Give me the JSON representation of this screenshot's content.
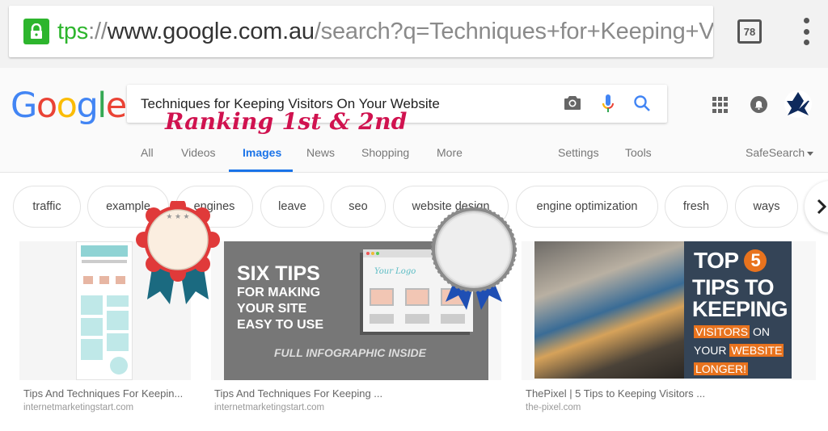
{
  "browser": {
    "url": {
      "scheme": "tps",
      "separator": "://",
      "host": "www.google.com.au",
      "path": "/search?q=Techniques+for+Keeping+V"
    },
    "tab_count": "78",
    "icons": [
      "lock-icon",
      "tab-switcher-icon",
      "overflow-menu-icon"
    ]
  },
  "google": {
    "logo": [
      "G",
      "o",
      "o",
      "g",
      "l",
      "e"
    ],
    "search": {
      "query": "Techniques for Keeping Visitors On Your Website",
      "icons": [
        "camera-icon",
        "microphone-icon",
        "search-icon"
      ]
    },
    "annotation": "Ranking 1st & 2nd",
    "header_icons": [
      "apps-grid-icon",
      "notifications-icon",
      "account-avatar"
    ],
    "nav": {
      "tabs": [
        {
          "label": "All",
          "active": false
        },
        {
          "label": "Videos",
          "active": false
        },
        {
          "label": "Images",
          "active": true
        },
        {
          "label": "News",
          "active": false
        },
        {
          "label": "Shopping",
          "active": false
        },
        {
          "label": "More",
          "active": false
        }
      ],
      "settings": "Settings",
      "tools": "Tools",
      "safesearch": "SafeSearch"
    },
    "chips": [
      "traffic",
      "example",
      "engines",
      "leave",
      "seo",
      "website design",
      "engine optimization",
      "fresh",
      "ways"
    ],
    "results": [
      {
        "title": "Tips And Techniques For Keepin...",
        "source": "internetmarketingstart.com",
        "badge": "first-place-ribbon"
      },
      {
        "title": "Tips And Techniques For Keeping ...",
        "source": "internetmarketingstart.com",
        "badge": "second-place-ribbon",
        "image_text": {
          "headline": "SIX TIPS",
          "lines": [
            "FOR MAKING",
            "YOUR SITE",
            "EASY TO USE"
          ],
          "footer": "FULL INFOGRAPHIC INSIDE",
          "mock_logo": "Your Logo"
        }
      },
      {
        "title": "ThePixel | 5 Tips to Keeping Visitors ...",
        "source": "the-pixel.com",
        "image_text": {
          "line1": "TOP",
          "number": "5",
          "line2": "TIPS TO",
          "line3": "KEEPING",
          "hl1": "VISITORS",
          "w1": "ON",
          "w2": "YOUR",
          "hl2": "WEBSITE",
          "hl3": "LONGER!"
        }
      }
    ]
  },
  "colors": {
    "google_blue": "#4285f4",
    "google_red": "#ea4335",
    "google_yellow": "#fbbc05",
    "google_green": "#34a853",
    "active_tab": "#1a73e8",
    "annotation": "#d0124f",
    "secure_green": "#2db52d"
  }
}
